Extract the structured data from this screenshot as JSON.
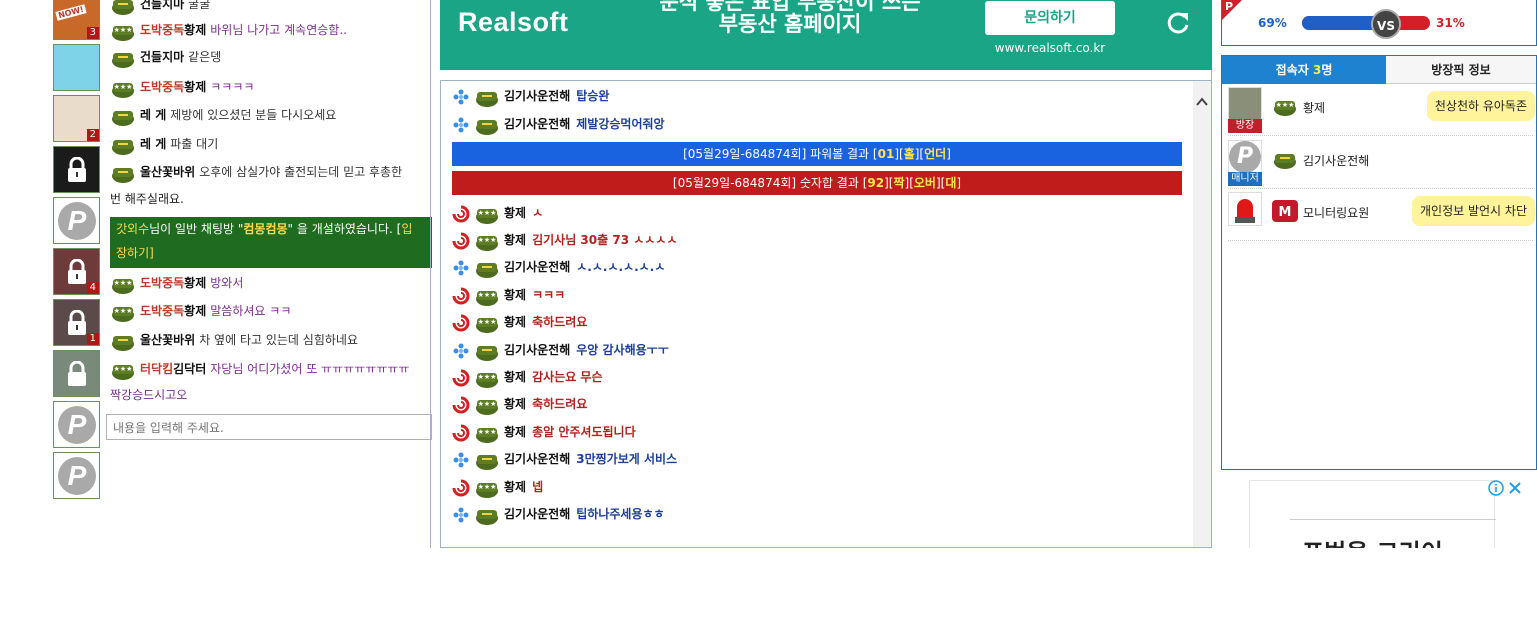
{
  "left_thumbs": [
    {
      "kind": "image",
      "label": "NOW!",
      "count": "3",
      "bg": "#c8692a"
    },
    {
      "kind": "image",
      "label": "",
      "count": "",
      "bg": "#7fd3e8"
    },
    {
      "kind": "image",
      "label": "",
      "count": "2",
      "bg": "#e9dccb"
    },
    {
      "kind": "lock-dark",
      "count": ""
    },
    {
      "kind": "p",
      "count": ""
    },
    {
      "kind": "lock",
      "count": "4",
      "bg": "#6e3a3a"
    },
    {
      "kind": "lock",
      "count": "1",
      "bg": "#5a4a4a"
    },
    {
      "kind": "ghost",
      "count": ""
    },
    {
      "kind": "p",
      "count": ""
    },
    {
      "kind": "p",
      "count": ""
    }
  ],
  "left_chat": {
    "rows": [
      {
        "nick_pre": "",
        "nick": "건들지마",
        "msg": "굴굴",
        "msg_style": "dark"
      },
      {
        "nick_pre": "도박중독",
        "nick": "황제",
        "msg": "바위님 나가고 계속연승함..",
        "msg_style": "purple"
      },
      {
        "nick_pre": "",
        "nick": "건들지마",
        "msg": "같은뎅",
        "msg_style": "dark"
      },
      {
        "nick_pre": "도박중독",
        "nick": "황제",
        "msg": "ㅋㅋㅋㅋ",
        "msg_style": "purple"
      },
      {
        "nick_pre": "",
        "nick": "레 게",
        "msg": "제방에 있으셨던 분들 다시오세요",
        "msg_style": "dark"
      },
      {
        "nick_pre": "",
        "nick": "레 게",
        "msg": "파출 대기",
        "msg_style": "dark"
      },
      {
        "nick_pre": "",
        "nick": "울산꽃바위",
        "msg": "오후에 삼실가야 출전되는데 믿고 후총한",
        "msg_style": "dark"
      }
    ],
    "wrap_line": "번 해주실래요.",
    "notice_line1_pre": "갓외수",
    "notice_line1_mid": "님이 일반 채팅방 \"",
    "notice_room": "컴몽컴몽",
    "notice_line1_post": "\" 을 개설하였습니다. [",
    "notice_line1_bracket": "입",
    "notice_line2": "장하기]",
    "rows2": [
      {
        "nick_pre": "도박중독",
        "nick": "황제",
        "msg": "방와서",
        "msg_style": "purple"
      },
      {
        "nick_pre": "도박중독",
        "nick": "황제",
        "msg": "말씀하셔요 ㅋㅋ",
        "msg_style": "purple"
      },
      {
        "nick_pre": "",
        "nick": "울산꽃바위",
        "msg": "차 옆에 타고 있는데 심힘하네요",
        "msg_style": "dark"
      },
      {
        "nick_pre": "터닥킴",
        "nick": "김닥터",
        "msg": "자당님 어디가셨어 또 ㅠㅠㅠㅠㅠㅠㅠㅠ",
        "msg_style": "purple"
      }
    ],
    "wrap_line2": "짝강승드시고오",
    "input_placeholder": "내용을 입력해 주세요."
  },
  "banner": {
    "logo": "Realsoft",
    "line1": "분석 좋은 표입 부동산이 쓰는",
    "line2": "부동산 홈페이지",
    "button": "문의하기",
    "url": "www.realsoft.co.kr"
  },
  "center_chat": {
    "rows_a": [
      {
        "icon": "blue",
        "nick": "김기사운전해",
        "msg": "탑승완",
        "color": "blue"
      },
      {
        "icon": "blue",
        "nick": "김기사운전해",
        "msg": "제발강승먹어줘앙",
        "color": "blue"
      }
    ],
    "notice_blue": {
      "pre": "[05월29일-684874회] 파워볼 결과 [",
      "a": "01",
      "mid": "][",
      "b": "홀",
      "mid2": "][",
      "c": "언더",
      "post": "]",
      "bg": "#1a63e0"
    },
    "notice_red": {
      "pre": "[05월29일-684874회] 숫자합 결과 [",
      "a": "92",
      "mid": "][",
      "b": "짝",
      "mid2": "][",
      "c": "오버",
      "mid3": "][",
      "d": "대",
      "post": "]",
      "bg": "#c01c1c"
    },
    "rows_b": [
      {
        "icon": "red",
        "nick": "황제",
        "msg": "ㅅ",
        "color": "red"
      },
      {
        "icon": "red",
        "nick": "황제",
        "msg": "김기사님 30출 73 ㅅㅅㅅㅅ",
        "color": "red"
      },
      {
        "icon": "blue",
        "nick": "김기사운전해",
        "msg": "ㅅ.ㅅ.ㅅ.ㅅ.ㅅ.ㅅ",
        "color": "blue"
      },
      {
        "icon": "red",
        "nick": "황제",
        "msg": "ㅋㅋㅋ",
        "color": "red"
      },
      {
        "icon": "red",
        "nick": "황제",
        "msg": "축하드려요",
        "color": "red"
      },
      {
        "icon": "blue",
        "nick": "김기사운전해",
        "msg": "우앙 감사해용ㅜㅜ",
        "color": "blue"
      },
      {
        "icon": "red",
        "nick": "황제",
        "msg": "감사는요 무슨",
        "color": "red"
      },
      {
        "icon": "red",
        "nick": "황제",
        "msg": "축하드려요",
        "color": "red"
      },
      {
        "icon": "red",
        "nick": "황제",
        "msg": "총알 안주셔도됩니다",
        "color": "red"
      },
      {
        "icon": "blue",
        "nick": "김기사운전해",
        "msg": "3만찡가보게 서비스",
        "color": "blue"
      },
      {
        "icon": "red",
        "nick": "황제",
        "msg": "넵",
        "color": "red"
      },
      {
        "icon": "blue",
        "nick": "김기사운전해",
        "msg": "팁하나주세용ㅎㅎ",
        "color": "blue"
      }
    ]
  },
  "vs_bar": {
    "left_pct": "69%",
    "right_pct": "31%",
    "vs": "VS",
    "left_value": 69,
    "right_value": 31
  },
  "right_panel": {
    "tab_users_pre": "접속자 ",
    "tab_users_count": "3",
    "tab_users_post": "명",
    "tab_info": "방장픽 정보",
    "users": [
      {
        "badge": "방장",
        "badge_color": "#c0202a",
        "nick": "황제",
        "bubble": "천상천하 유아독존"
      },
      {
        "badge": "매니저",
        "badge_color": "#1e6fc0",
        "nick": "김기사운전해",
        "bubble": ""
      },
      {
        "badge": "",
        "badge_color": "",
        "nick": "모니터링요원",
        "bubble": "개인정보 발언시 차단"
      }
    ]
  },
  "ad_text": "표범을 그리이"
}
